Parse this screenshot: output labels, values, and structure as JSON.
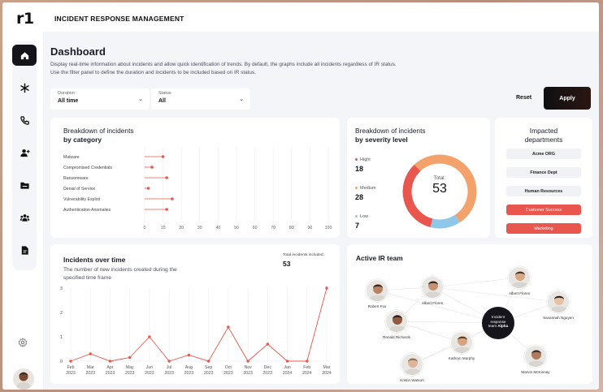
{
  "app": {
    "logo": "r1",
    "title": "INCIDENT RESPONSE MANAGEMENT"
  },
  "page": {
    "title": "Dashboard",
    "description_1": "Display real-time information about incidents and allow quick identification of trends. By default, the graphs include all incidents regardless of IR status.",
    "description_2": "Use the filter panel to define the duration and incidents to be included based on IR status."
  },
  "filters": {
    "duration": {
      "label": "Duration",
      "value": "All time"
    },
    "status": {
      "label": "Status",
      "value": "All"
    },
    "reset_label": "Reset",
    "apply_label": "Apply"
  },
  "sidebar": {
    "items": [
      {
        "name": "home-icon",
        "active": true
      },
      {
        "name": "asterisk-icon"
      },
      {
        "name": "phone-icon"
      },
      {
        "name": "add-user-icon"
      },
      {
        "name": "folder-icon"
      },
      {
        "name": "team-icon"
      },
      {
        "name": "document-icon"
      }
    ],
    "settings_icon": "gear-icon"
  },
  "category_card": {
    "title_1": "Breakdown of incidents",
    "title_2": "by category"
  },
  "severity_card": {
    "title_1": "Breakdown of incidents",
    "title_2": "by severity level",
    "total_label": "Total:",
    "total": "53"
  },
  "departments": {
    "title_1": "Impacted",
    "title_2": "departments",
    "items": [
      {
        "label": "Acme ORG",
        "hot": false
      },
      {
        "label": "Finance Dept",
        "hot": false
      },
      {
        "label": "Human Resources",
        "hot": false
      },
      {
        "label": "Customer Success",
        "hot": true
      },
      {
        "label": "Marketing",
        "hot": true
      }
    ]
  },
  "timeline_card": {
    "title": "Incidents over time",
    "subtitle_1": "The number of new incidents created during the",
    "subtitle_2": "specified time frame",
    "total_label": "Total incidents included:",
    "total": "53"
  },
  "team_card": {
    "title": "Active IR team",
    "center_label_1": "Incident",
    "center_label_2": "response",
    "center_label_3": "team",
    "center_label_team": "Alpha",
    "members": [
      {
        "name": "Robert Fox"
      },
      {
        "name": "Albert Flores"
      },
      {
        "name": "Albert Flores"
      },
      {
        "name": "Savannah Nguyen"
      },
      {
        "name": "Ronald Richards"
      },
      {
        "name": "Kathryn Murphy"
      },
      {
        "name": "Marvin McKinney"
      },
      {
        "name": "Kristin Watson"
      }
    ]
  },
  "colors": {
    "accent": "#e8564e",
    "orange": "#f4a26b",
    "blue": "#8fc7ea",
    "dark": "#14141a"
  },
  "chart_data": [
    {
      "type": "scatter",
      "categories": [
        "Malware",
        "Compromised Credentials",
        "Ransomware",
        "Denial of Service",
        "Vulnerability Exploit",
        "Authentication Anomalies"
      ],
      "values": [
        10,
        4,
        12,
        2,
        15,
        12
      ],
      "xticks": [
        "0",
        "10",
        "20",
        "30",
        "40",
        "50",
        "60",
        "70",
        "80",
        "90",
        "100"
      ],
      "xlim": [
        0,
        100
      ],
      "grid": true
    },
    {
      "type": "pie",
      "categories": [
        "Hight",
        "Medium",
        "Low"
      ],
      "values": [
        18,
        28,
        7
      ],
      "colors": [
        "#e8564e",
        "#f4a26b",
        "#8fc7ea"
      ]
    },
    {
      "type": "line",
      "x": [
        "Feb\n2023",
        "Mar\n2023",
        "Apr\n2023",
        "May\n2023",
        "Jun\n2023",
        "Jul\n2023",
        "Aug\n2023",
        "Sep\n2023",
        "Oct\n2023",
        "Nov\n2023",
        "Dec\n2023",
        "Jan\n2024",
        "Feb\n2024",
        "Mar\n2024"
      ],
      "values": [
        0,
        0.3,
        0,
        0.15,
        1,
        0,
        0.25,
        0,
        1.4,
        0,
        0.7,
        0,
        0,
        3
      ],
      "ylim": [
        0,
        3
      ],
      "yticks": [
        "0",
        "1",
        "2",
        "3"
      ],
      "grid": true
    }
  ]
}
